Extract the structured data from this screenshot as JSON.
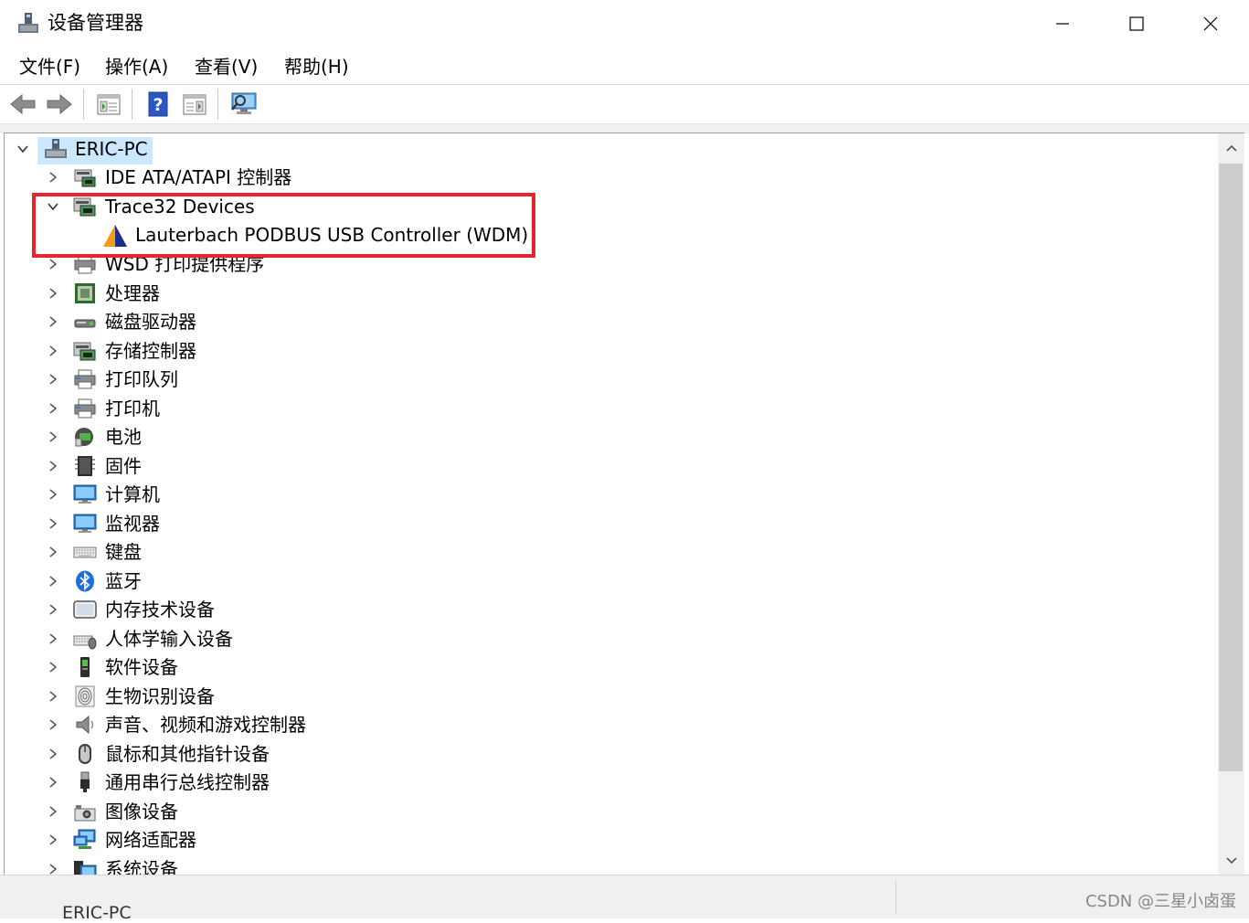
{
  "window": {
    "title": "设备管理器"
  },
  "menu": [
    {
      "label": "文件(F)"
    },
    {
      "label": "操作(A)"
    },
    {
      "label": "查看(V)"
    },
    {
      "label": "帮助(H)"
    }
  ],
  "toolbar": {
    "buttons": [
      "back-icon",
      "forward-icon",
      "properties-icon",
      "help-icon",
      "update-driver-icon",
      "scan-hardware-icon"
    ]
  },
  "tree": {
    "root": {
      "label": "ERIC-PC",
      "icon": "computer-icon",
      "expanded": true
    },
    "items": [
      {
        "label": "IDE ATA/ATAPI 控制器",
        "icon": "ide-controller-icon",
        "expanded": false
      },
      {
        "label": "Trace32 Devices",
        "icon": "trace32-devices-icon",
        "expanded": true
      },
      {
        "label": "Lauterbach PODBUS USB Controller (WDM)",
        "icon": "lauterbach-icon",
        "child": true
      },
      {
        "label": "WSD 打印提供程序",
        "icon": "printer-icon",
        "expanded": false
      },
      {
        "label": "处理器",
        "icon": "processor-icon",
        "expanded": false
      },
      {
        "label": "磁盘驱动器",
        "icon": "disk-drive-icon",
        "expanded": false
      },
      {
        "label": "存储控制器",
        "icon": "storage-controller-icon",
        "expanded": false
      },
      {
        "label": "打印队列",
        "icon": "print-queue-icon",
        "expanded": false
      },
      {
        "label": "打印机",
        "icon": "printer-icon",
        "expanded": false
      },
      {
        "label": "电池",
        "icon": "battery-icon",
        "expanded": false
      },
      {
        "label": "固件",
        "icon": "firmware-icon",
        "expanded": false
      },
      {
        "label": "计算机",
        "icon": "monitor-icon",
        "expanded": false
      },
      {
        "label": "监视器",
        "icon": "monitor-icon",
        "expanded": false
      },
      {
        "label": "键盘",
        "icon": "keyboard-icon",
        "expanded": false
      },
      {
        "label": "蓝牙",
        "icon": "bluetooth-icon",
        "expanded": false
      },
      {
        "label": "内存技术设备",
        "icon": "memory-device-icon",
        "expanded": false
      },
      {
        "label": "人体学输入设备",
        "icon": "hid-icon",
        "expanded": false
      },
      {
        "label": "软件设备",
        "icon": "software-device-icon",
        "expanded": false
      },
      {
        "label": "生物识别设备",
        "icon": "fingerprint-icon",
        "expanded": false
      },
      {
        "label": "声音、视频和游戏控制器",
        "icon": "speaker-icon",
        "expanded": false
      },
      {
        "label": "鼠标和其他指针设备",
        "icon": "mouse-icon",
        "expanded": false
      },
      {
        "label": "通用串行总线控制器",
        "icon": "usb-icon",
        "expanded": false
      },
      {
        "label": "图像设备",
        "icon": "camera-icon",
        "expanded": false
      },
      {
        "label": "网络适配器",
        "icon": "network-adapter-icon",
        "expanded": false
      },
      {
        "label": "系统设备",
        "icon": "system-device-icon",
        "expanded": false
      }
    ]
  },
  "statusbar": {
    "watermark": "CSDN @三星小卤蛋",
    "bottom_fragment": "ERIC-PC"
  },
  "colors": {
    "highlight_border": "#e8252f",
    "selection": "#cce8ff"
  }
}
